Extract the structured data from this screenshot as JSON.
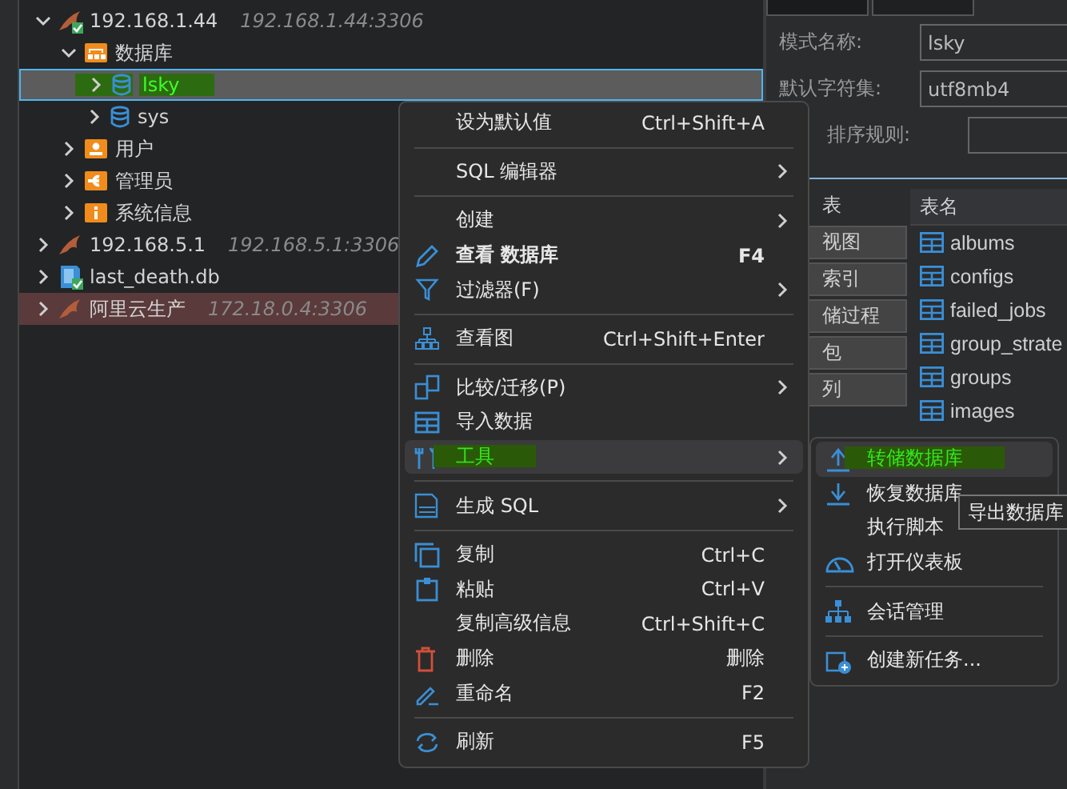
{
  "tree": [
    {
      "kind": "connection",
      "label": "192.168.1.44",
      "detail": "192.168.1.44:3306",
      "expanded": true,
      "connected": true,
      "selected": false,
      "marked": false,
      "children": [
        {
          "kind": "databases",
          "label": "数据库",
          "expanded": true,
          "selected": false,
          "marked": false,
          "children": [
            {
              "kind": "database",
              "label": "lsky",
              "expanded": false,
              "selected": true,
              "marked": true
            },
            {
              "kind": "database",
              "label": "sys",
              "expanded": false,
              "selected": false,
              "marked": false
            }
          ]
        },
        {
          "kind": "users",
          "label": "用户",
          "expanded": false,
          "selected": false,
          "marked": false
        },
        {
          "kind": "admins",
          "label": "管理员",
          "expanded": false,
          "selected": false,
          "marked": false
        },
        {
          "kind": "info",
          "label": "系统信息",
          "expanded": false,
          "selected": false,
          "marked": false
        }
      ]
    },
    {
      "kind": "connection",
      "label": "192.168.5.1",
      "detail": "192.168.5.1:3306",
      "expanded": false,
      "connected": false,
      "selected": false,
      "marked": false
    },
    {
      "kind": "file",
      "label": "last_death.db",
      "expanded": false,
      "connected": true,
      "selected": false,
      "marked": false
    },
    {
      "kind": "connection",
      "label": "阿里云生产",
      "detail": "172.18.0.4:3306",
      "expanded": false,
      "connected": false,
      "selected": false,
      "marked": false,
      "color": "#5b3a3b"
    }
  ],
  "properties": [
    {
      "label": "模式名称:",
      "value": "lsky"
    },
    {
      "label": "默认字符集:",
      "value": "utf8mb4"
    },
    {
      "label": "排序规则:"
    }
  ],
  "categories": [
    {
      "label": "表",
      "selected": true
    },
    {
      "label": "视图",
      "selected": false
    },
    {
      "label": "索引",
      "selected": false
    },
    {
      "label": "储过程",
      "selected": false
    },
    {
      "label": "包",
      "selected": false
    },
    {
      "label": "列",
      "selected": false
    }
  ],
  "tables": {
    "header": "表名",
    "rows": [
      "albums",
      "configs",
      "failed_jobs",
      "group_strate",
      "groups",
      "images"
    ]
  },
  "context_menu": [
    {
      "kind": "item",
      "label": "设为默认值",
      "shortcut": "Ctrl+Shift+A",
      "submenu": false,
      "selected": false,
      "marked": false
    },
    {
      "kind": "separator"
    },
    {
      "kind": "item",
      "label": "SQL 编辑器",
      "submenu": true,
      "selected": false,
      "marked": false
    },
    {
      "kind": "separator"
    },
    {
      "kind": "item",
      "label": "创建",
      "submenu": true,
      "selected": false,
      "marked": false
    },
    {
      "kind": "default_item",
      "label": "查看 数据库",
      "shortcut": "F4",
      "submenu": false,
      "selected": false,
      "marked": false
    },
    {
      "kind": "item",
      "label": "过滤器(F)",
      "submenu": true,
      "selected": false,
      "marked": false
    },
    {
      "kind": "separator"
    },
    {
      "kind": "item",
      "label": "查看图",
      "shortcut": "Ctrl+Shift+Enter",
      "submenu": false,
      "selected": false,
      "marked": false
    },
    {
      "kind": "separator"
    },
    {
      "kind": "item",
      "label": "比较/迁移(P)",
      "submenu": true,
      "selected": false,
      "marked": false
    },
    {
      "kind": "item",
      "label": "导入数据",
      "submenu": false,
      "selected": false,
      "marked": false
    },
    {
      "kind": "item",
      "label": "工具",
      "submenu": true,
      "selected": true,
      "marked": true
    },
    {
      "kind": "separator"
    },
    {
      "kind": "item",
      "label": "生成 SQL",
      "submenu": true,
      "selected": false,
      "marked": false
    },
    {
      "kind": "separator"
    },
    {
      "kind": "item",
      "label": "复制",
      "shortcut": "Ctrl+C",
      "submenu": false,
      "selected": false,
      "marked": false
    },
    {
      "kind": "item",
      "label": "粘贴",
      "shortcut": "Ctrl+V",
      "submenu": false,
      "selected": false,
      "marked": false
    },
    {
      "kind": "item",
      "label": "复制高级信息",
      "shortcut": "Ctrl+Shift+C",
      "submenu": false,
      "selected": false,
      "marked": false
    },
    {
      "kind": "item",
      "label": "删除",
      "shortcut": "删除",
      "submenu": false,
      "selected": false,
      "marked": false
    },
    {
      "kind": "item",
      "label": "重命名",
      "shortcut": "F2",
      "submenu": false,
      "selected": false,
      "marked": false
    },
    {
      "kind": "separator"
    },
    {
      "kind": "item",
      "label": "刷新",
      "shortcut": "F5",
      "submenu": false,
      "selected": false,
      "marked": false
    }
  ],
  "tools_submenu": [
    {
      "kind": "item",
      "label": "转储数据库",
      "selected": true,
      "marked": true
    },
    {
      "kind": "item",
      "label": "恢复数据库",
      "selected": false,
      "marked": false
    },
    {
      "kind": "item",
      "label": "执行脚本",
      "selected": false,
      "marked": false
    },
    {
      "kind": "item",
      "label": "打开仪表板",
      "selected": false,
      "marked": false
    },
    {
      "kind": "separator"
    },
    {
      "kind": "item",
      "label": "会话管理",
      "selected": false,
      "marked": false
    },
    {
      "kind": "separator"
    },
    {
      "kind": "item",
      "label": "创建新任务...",
      "selected": false,
      "marked": false
    }
  ],
  "tooltip": "导出数据库"
}
